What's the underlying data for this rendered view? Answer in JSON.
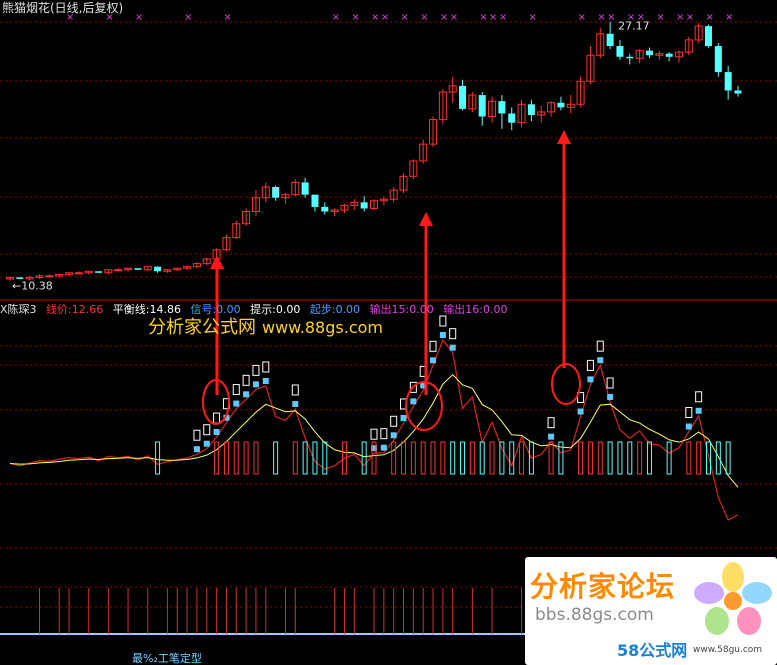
{
  "title": "熊猫烟花(日线,后复权)",
  "price_high_label": "27.17",
  "price_low_label": "←10.38",
  "indicator_bar": {
    "name": "X陈琛3",
    "items": [
      {
        "text": "线价:12.66",
        "color": "#ff3030"
      },
      {
        "text": "平衡线:14.86",
        "color": "#ffffff"
      },
      {
        "text": "信号:0.00",
        "color": "#3aa0ff"
      },
      {
        "text": "提示:0.00",
        "color": "#ffffff"
      },
      {
        "text": "起步:0.00",
        "color": "#3aa0ff"
      },
      {
        "text": "输出15:0.00",
        "color": "#e040e0"
      },
      {
        "text": "输出16:0.00",
        "color": "#e040e0"
      }
    ]
  },
  "watermark": {
    "cn": "分析家公式网",
    "url": "www.88gs.com"
  },
  "logo": {
    "title": "分析家论坛",
    "url": "bbs.88gs.com",
    "site": "58公式网",
    "site_url": "www.58gu.com"
  },
  "bottom_label": "最%₂工笔定型",
  "colors": {
    "up": "#ff3030",
    "down": "#54ffff",
    "balance": "#ffff66",
    "marker": "#e040e0",
    "grid": "#9a0000",
    "arrow": "#ff1a1a"
  },
  "chart_data": {
    "type": "candlestick",
    "candles": [
      [
        10.4,
        10.5,
        10.3,
        10.5
      ],
      [
        10.5,
        10.5,
        10.4,
        10.4
      ],
      [
        10.4,
        10.6,
        10.3,
        10.5
      ],
      [
        10.5,
        10.7,
        10.4,
        10.6
      ],
      [
        10.6,
        10.7,
        10.5,
        10.6
      ],
      [
        10.6,
        10.7,
        10.5,
        10.7
      ],
      [
        10.7,
        10.8,
        10.6,
        10.8
      ],
      [
        10.8,
        10.9,
        10.7,
        10.8
      ],
      [
        10.8,
        10.9,
        10.7,
        10.9
      ],
      [
        10.9,
        10.9,
        10.8,
        10.8
      ],
      [
        10.8,
        11.0,
        10.7,
        11.0
      ],
      [
        11.0,
        11.1,
        10.9,
        11.0
      ],
      [
        11.0,
        11.1,
        10.9,
        11.1
      ],
      [
        11.1,
        11.1,
        11.0,
        11.0
      ],
      [
        11.0,
        11.2,
        10.9,
        11.2
      ],
      [
        11.2,
        11.2,
        10.8,
        10.9
      ],
      [
        10.9,
        11.0,
        10.8,
        11.0
      ],
      [
        11.0,
        11.1,
        10.9,
        11.1
      ],
      [
        11.1,
        11.3,
        11.0,
        11.2
      ],
      [
        11.2,
        11.5,
        11.1,
        11.4
      ],
      [
        11.4,
        11.8,
        11.3,
        11.7
      ],
      [
        11.7,
        12.4,
        11.6,
        12.3
      ],
      [
        12.3,
        13.3,
        12.2,
        13.1
      ],
      [
        13.1,
        14.2,
        13.0,
        14.0
      ],
      [
        14.0,
        15.0,
        13.9,
        14.8
      ],
      [
        14.8,
        16.2,
        14.5,
        15.7
      ],
      [
        15.7,
        16.7,
        15.4,
        16.4
      ],
      [
        16.4,
        16.5,
        15.5,
        15.7
      ],
      [
        15.7,
        16.0,
        15.3,
        15.9
      ],
      [
        15.9,
        16.9,
        15.8,
        16.7
      ],
      [
        16.7,
        17.0,
        15.7,
        15.9
      ],
      [
        15.9,
        15.9,
        14.8,
        15.1
      ],
      [
        15.1,
        15.4,
        14.6,
        14.8
      ],
      [
        14.8,
        15.0,
        14.5,
        14.9
      ],
      [
        14.9,
        15.3,
        14.7,
        15.2
      ],
      [
        15.2,
        15.6,
        14.9,
        15.4
      ],
      [
        15.4,
        15.8,
        14.8,
        15.0
      ],
      [
        15.0,
        15.6,
        14.9,
        15.5
      ],
      [
        15.5,
        15.8,
        15.2,
        15.6
      ],
      [
        15.6,
        16.4,
        15.4,
        16.2
      ],
      [
        16.2,
        17.3,
        16.0,
        17.1
      ],
      [
        17.1,
        18.2,
        16.9,
        18.1
      ],
      [
        18.1,
        19.5,
        17.9,
        19.2
      ],
      [
        19.2,
        21.0,
        19.0,
        20.8
      ],
      [
        20.8,
        22.8,
        20.5,
        22.6
      ],
      [
        22.6,
        23.6,
        21.9,
        23.0
      ],
      [
        23.0,
        23.4,
        21.4,
        21.5
      ],
      [
        21.5,
        22.6,
        21.3,
        22.4
      ],
      [
        22.4,
        22.6,
        20.4,
        21.0
      ],
      [
        21.0,
        22.3,
        20.6,
        22.0
      ],
      [
        22.0,
        22.4,
        20.2,
        21.2
      ],
      [
        21.2,
        21.6,
        20.1,
        20.6
      ],
      [
        20.6,
        22.1,
        20.3,
        21.8
      ],
      [
        21.8,
        22.1,
        20.7,
        21.1
      ],
      [
        21.1,
        21.7,
        20.6,
        21.3
      ],
      [
        21.3,
        22.0,
        21.0,
        21.9
      ],
      [
        21.9,
        22.3,
        21.4,
        21.6
      ],
      [
        21.6,
        22.4,
        21.2,
        21.8
      ],
      [
        21.8,
        23.6,
        21.6,
        23.3
      ],
      [
        23.3,
        25.6,
        23.1,
        25.0
      ],
      [
        25.0,
        26.8,
        24.8,
        26.4
      ],
      [
        26.4,
        27.2,
        25.4,
        25.6
      ],
      [
        25.6,
        26.0,
        24.7,
        24.9
      ],
      [
        24.9,
        25.1,
        24.4,
        24.8
      ],
      [
        24.8,
        25.4,
        24.5,
        25.3
      ],
      [
        25.3,
        25.5,
        24.8,
        25.0
      ],
      [
        25.0,
        25.3,
        24.7,
        25.1
      ],
      [
        25.1,
        25.2,
        24.6,
        24.9
      ],
      [
        24.9,
        25.3,
        24.5,
        25.2
      ],
      [
        25.2,
        26.2,
        25.0,
        26.0
      ],
      [
        26.0,
        27.1,
        25.8,
        26.9
      ],
      [
        26.9,
        27.0,
        25.5,
        25.6
      ],
      [
        25.6,
        25.8,
        23.6,
        23.9
      ],
      [
        23.9,
        24.3,
        22.1,
        22.7
      ],
      [
        22.7,
        23.0,
        22.3,
        22.5
      ]
    ],
    "markers": [
      6,
      10,
      13,
      18,
      22,
      33,
      35,
      37,
      38,
      40,
      42,
      44,
      45,
      48,
      49,
      50,
      53,
      58,
      60,
      61,
      63,
      64,
      66,
      68,
      69,
      71,
      73
    ]
  }
}
